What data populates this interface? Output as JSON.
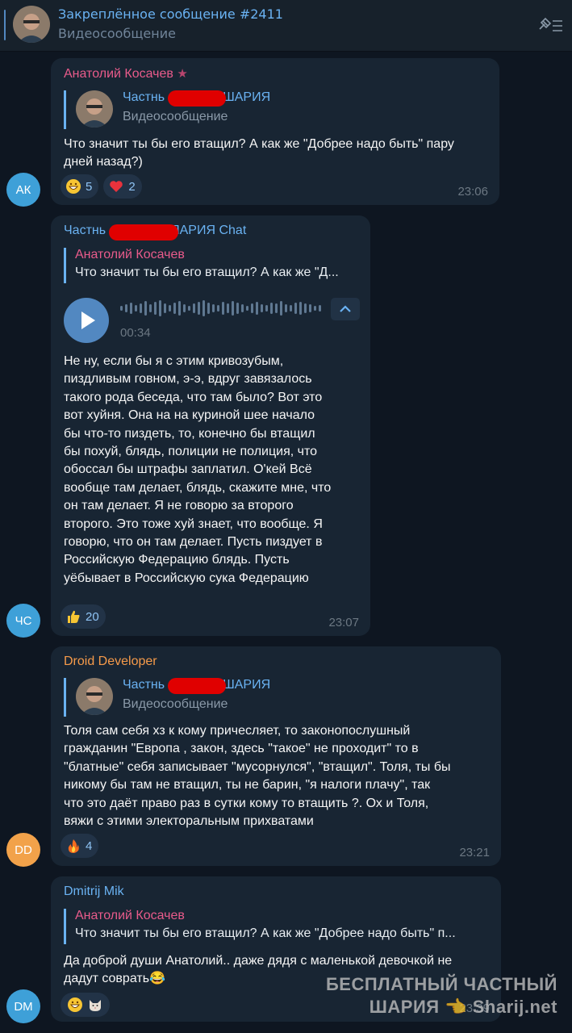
{
  "pinned": {
    "title": "Закреплённое сообщение #2411",
    "subtitle": "Видеосообщение",
    "unpin_icon": "unpin-list-icon"
  },
  "messages": [
    {
      "avatar_initials": "АК",
      "avatar_color": "#3ea0d8",
      "sender": "Анатолий Косачев",
      "sender_color": "#e95b8b",
      "reply_name": "Частнь",
      "reply_name_tail": "ШАРИЯ",
      "reply_sub": "Видеосообщение",
      "text": "Что значит ты бы его втащил? А как же \"Добрее надо быть\" пару\nдней назад?)",
      "reactions": [
        {
          "emoji": "grinning-face",
          "count": "5"
        },
        {
          "emoji": "red-heart",
          "count": "2"
        }
      ],
      "time": "23:06"
    },
    {
      "avatar_initials": "ЧС",
      "avatar_color": "#3ea0d8",
      "sender": "Частнь",
      "sender_tail": "ЯАРИЯ Chat",
      "sender_color": "#6ab2f2",
      "reply_name": "Анатолий Косачев",
      "reply_name_color": "#e95b8b",
      "reply_text": "Что значит ты бы его втащил? А как же \"Д...",
      "voice_duration": "00:34",
      "text": "Не ну, если бы я с этим кривозубым,\nпиздливым говном, э-э, вдруг завязалось\nтакого рода беседа, что там было? Вот это\nвот хуйня. Она на на куриной шее начало\nбы что-то пиздеть, то, конечно бы втащил\nбы похуй, блядь, полиции не полиция, что\nобоссал бы штрафы заплатил. О'кей Всё\nвообще там делает, блядь, скажите мне, что\nон там делает. Я не говорю за второго\nвторого. Это тоже хуй знает, что вообще. Я\nговорю, что он там делает. Пусть пиздует в\nРоссийскую Федерацию блядь. Пусть\nуёбывает в Российскую сука Федерацию",
      "reactions": [
        {
          "emoji": "thumbs-up",
          "count": "20"
        }
      ],
      "time": "23:07"
    },
    {
      "avatar_initials": "DD",
      "avatar_color": "#f2a24a",
      "sender": "Droid Developer",
      "sender_color": "#f59a4a",
      "reply_name": "Частнь",
      "reply_name_tail": "ШАРИЯ",
      "reply_sub": "Видеосообщение",
      "text": "Толя сам себя хз к кому причесляет, то законопослушный\nгражданин \"Европа , закон, здесь \"такое\" не проходит\" то в\n\"блатные\" себя записывает \"мусорнулся\", \"втащил\". Толя, ты бы\nникому бы там не втащил, ты не барин, \"я налоги плачу\", так\nчто это даёт право раз в сутки кому то втащить ?. Ох и Толя,\nвяжи с этими электоральным прихватами",
      "reactions": [
        {
          "emoji": "fire",
          "count": "4"
        }
      ],
      "time": "23:21"
    },
    {
      "avatar_initials": "DM",
      "avatar_color": "#3ea0d8",
      "sender": "Dmitrij Mik",
      "sender_color": "#6ab2f2",
      "reply_name": "Анатолий Косачев",
      "reply_name_color": "#e95b8b",
      "reply_text": "Что значит ты бы его втащил? А как же \"Добрее надо быть\" п...",
      "text": "Да доброй души Анатолий.. даже дядя с маленькой девочкой не\nдадут соврать😂",
      "reactions": [
        {
          "emoji": "grinning-face",
          "count": ""
        },
        {
          "emoji": "cat-face",
          "count": ""
        }
      ],
      "time": "23:39"
    }
  ],
  "watermark": {
    "line1": "БЕСПЛАТНЫЙ ЧАСТНЫЙ",
    "line2": "ШАРИЯ",
    "site": "Sharij.net"
  }
}
